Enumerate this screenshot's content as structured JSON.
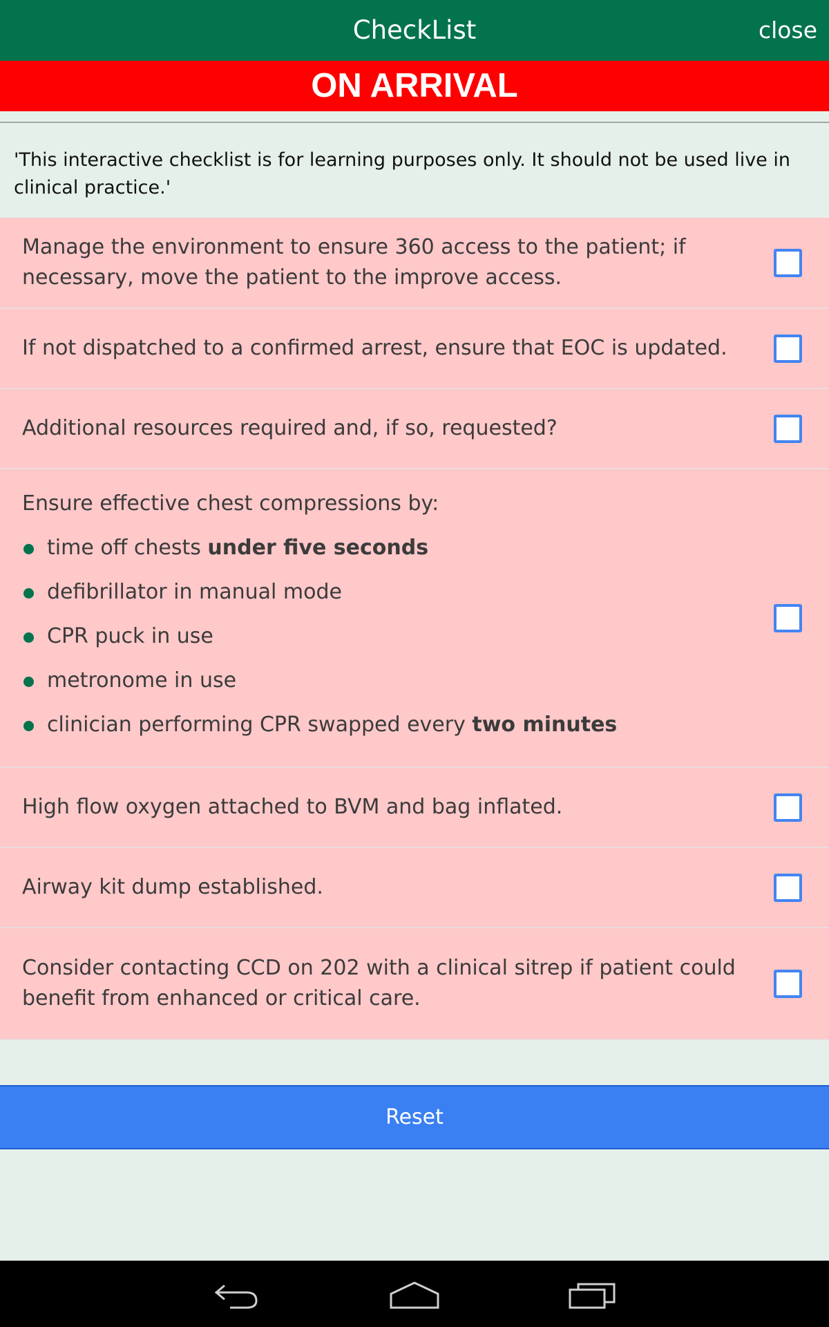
{
  "header": {
    "title": "CheckList",
    "close_label": "close"
  },
  "banner": {
    "title": "ON ARRIVAL"
  },
  "disclaimer": "'This interactive checklist is for learning purposes only. It should not be used live in clinical practice.'",
  "items": [
    {
      "text": "Manage the environment to ensure 360 access to the patient; if necessary, move the patient to the improve access.",
      "checked": false
    },
    {
      "text": "If not dispatched to a confirmed arrest, ensure that EOC is updated.",
      "checked": false
    },
    {
      "text": "Additional resources required and, if so, requested?",
      "checked": false
    },
    {
      "text": "Ensure effective chest compressions by:",
      "checked": false,
      "subitems": [
        {
          "text": "time off chests ",
          "bold": "under five seconds"
        },
        {
          "text": "defibrillator in manual mode",
          "bold": ""
        },
        {
          "text": "CPR puck in use",
          "bold": ""
        },
        {
          "text": "metronome in use",
          "bold": ""
        },
        {
          "text": "clinician performing CPR swapped every ",
          "bold": "two minutes"
        }
      ]
    },
    {
      "text": "High flow oxygen attached to BVM and bag inflated.",
      "checked": false
    },
    {
      "text": "Airway kit dump established.",
      "checked": false
    },
    {
      "text": "Consider contacting CCD on 202 with a clinical sitrep if patient could benefit from enhanced or critical care.",
      "checked": false
    }
  ],
  "reset_label": "Reset",
  "navbar": {
    "icons": [
      "back-icon",
      "home-icon",
      "recent-apps-icon"
    ]
  },
  "colors": {
    "header": "#03734d",
    "banner": "#ff0000",
    "item_bg": "#ffc8c9",
    "accent": "#3a80f2"
  }
}
